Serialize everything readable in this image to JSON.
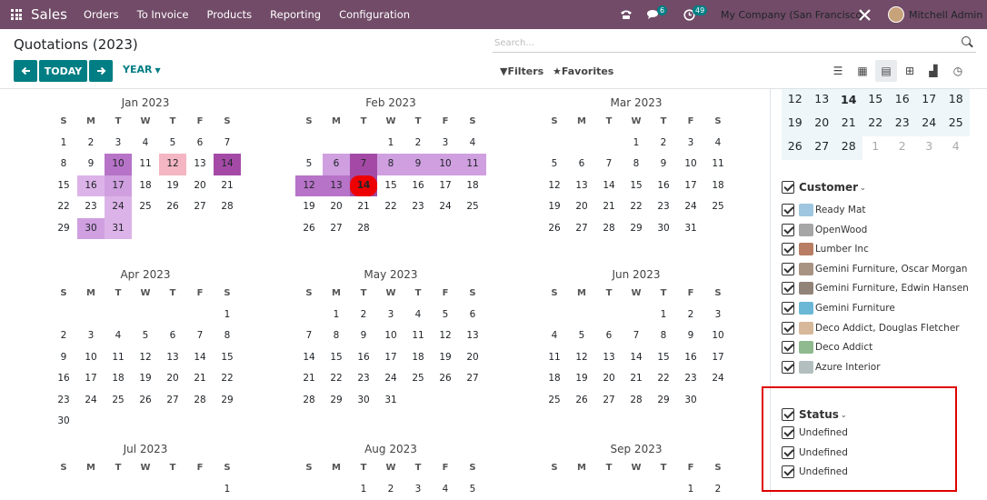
{
  "topbar": {
    "app_name": "Sales",
    "menu": [
      "Orders",
      "To Invoice",
      "Products",
      "Reporting",
      "Configuration"
    ],
    "chat_count": "6",
    "activity_count": "49",
    "company": "My Company (San Francisco)",
    "user": "Mitchell Admin",
    "colors": {
      "bar": "#714B67",
      "accent": "#017e84"
    }
  },
  "control": {
    "title": "Quotations (2023)",
    "today_label": "TODAY",
    "scale_label": "YEAR",
    "search_placeholder": "Search...",
    "filters_label": "Filters",
    "favorites_label": "Favorites"
  },
  "calendar": {
    "weekday_headers": [
      "S",
      "M",
      "T",
      "W",
      "T",
      "F",
      "S"
    ],
    "today_date": "Feb 14",
    "months": [
      {
        "name": "Jan 2023",
        "weeks": [
          [
            "1",
            "2",
            "3",
            "4",
            "5",
            "6",
            "7"
          ],
          [
            "8",
            "9",
            "10",
            "11",
            "12",
            "13",
            "14"
          ],
          [
            "15",
            "16",
            "17",
            "18",
            "19",
            "20",
            "21"
          ],
          [
            "22",
            "23",
            "24",
            "25",
            "26",
            "27",
            "28"
          ],
          [
            "29",
            "30",
            "31",
            "",
            "",
            "",
            ""
          ]
        ]
      },
      {
        "name": "Feb 2023",
        "weeks": [
          [
            "",
            "",
            "",
            "1",
            "2",
            "3",
            "4"
          ],
          [
            "5",
            "6",
            "7",
            "8",
            "9",
            "10",
            "11"
          ],
          [
            "12",
            "13",
            "14",
            "15",
            "16",
            "17",
            "18"
          ],
          [
            "19",
            "20",
            "21",
            "22",
            "23",
            "24",
            "25"
          ],
          [
            "26",
            "27",
            "28",
            "",
            "",
            "",
            ""
          ]
        ]
      },
      {
        "name": "Mar 2023",
        "weeks": [
          [
            "",
            "",
            "",
            "1",
            "2",
            "3",
            "4"
          ],
          [
            "5",
            "6",
            "7",
            "8",
            "9",
            "10",
            "11"
          ],
          [
            "12",
            "13",
            "14",
            "15",
            "16",
            "17",
            "18"
          ],
          [
            "19",
            "20",
            "21",
            "22",
            "23",
            "24",
            "25"
          ],
          [
            "26",
            "27",
            "28",
            "29",
            "30",
            "31",
            ""
          ]
        ]
      },
      {
        "name": "Apr 2023",
        "weeks": [
          [
            "",
            "",
            "",
            "",
            "",
            "",
            "1"
          ],
          [
            "2",
            "3",
            "4",
            "5",
            "6",
            "7",
            "8"
          ],
          [
            "9",
            "10",
            "11",
            "12",
            "13",
            "14",
            "15"
          ],
          [
            "16",
            "17",
            "18",
            "19",
            "20",
            "21",
            "22"
          ],
          [
            "23",
            "24",
            "25",
            "26",
            "27",
            "28",
            "29"
          ],
          [
            "30",
            "",
            "",
            "",
            "",
            "",
            ""
          ]
        ]
      },
      {
        "name": "May 2023",
        "weeks": [
          [
            "",
            "1",
            "2",
            "3",
            "4",
            "5",
            "6"
          ],
          [
            "7",
            "8",
            "9",
            "10",
            "11",
            "12",
            "13"
          ],
          [
            "14",
            "15",
            "16",
            "17",
            "18",
            "19",
            "20"
          ],
          [
            "21",
            "22",
            "23",
            "24",
            "25",
            "26",
            "27"
          ],
          [
            "28",
            "29",
            "30",
            "31",
            "",
            "",
            ""
          ]
        ]
      },
      {
        "name": "Jun 2023",
        "weeks": [
          [
            "",
            "",
            "",
            "",
            "1",
            "2",
            "3"
          ],
          [
            "4",
            "5",
            "6",
            "7",
            "8",
            "9",
            "10"
          ],
          [
            "11",
            "12",
            "13",
            "14",
            "15",
            "16",
            "17"
          ],
          [
            "18",
            "19",
            "20",
            "21",
            "22",
            "23",
            "24"
          ],
          [
            "25",
            "26",
            "27",
            "28",
            "29",
            "30",
            ""
          ]
        ]
      },
      {
        "name": "Jul 2023",
        "weeks": [
          [
            "",
            "",
            "",
            "",
            "",
            "",
            "1"
          ]
        ]
      },
      {
        "name": "Aug 2023",
        "weeks": [
          [
            "",
            "",
            "1",
            "2",
            "3",
            "4",
            "5"
          ]
        ]
      },
      {
        "name": "Sep 2023",
        "weeks": [
          [
            "",
            "",
            "",
            "",
            "",
            "1",
            "2"
          ]
        ]
      }
    ],
    "highlights": [
      {
        "month": 0,
        "days": {
          "10": "#b773c7",
          "12": "#f4b6c2",
          "14": "#a44aa6",
          "16": "#dcb3e8",
          "17": "#cf9fe0",
          "24": "#dcb3e8",
          "30": "#cf9fe0",
          "31": "#dcb3e8"
        }
      },
      {
        "month": 1,
        "days": {
          "6": "#cf9fe0",
          "7": "#a44aa6",
          "8": "#cf9fe0",
          "9": "#cf9fe0",
          "10": "#cf9fe0",
          "11": "#cf9fe0",
          "12": "#b773c7",
          "13": "#b773c7",
          "14": "#a44aa6"
        }
      }
    ]
  },
  "mini_calendar": {
    "rows": [
      [
        "12",
        "13",
        "14",
        "15",
        "16",
        "17",
        "18"
      ],
      [
        "19",
        "20",
        "21",
        "22",
        "23",
        "24",
        "25"
      ],
      [
        "26",
        "27",
        "28",
        "1",
        "2",
        "3",
        "4"
      ]
    ]
  },
  "filters": {
    "customer_title": "Customer",
    "customers": [
      "Ready Mat",
      "OpenWood",
      "Lumber Inc",
      "Gemini Furniture, Oscar Morgan",
      "Gemini Furniture, Edwin Hansen",
      "Gemini Furniture",
      "Deco Addict, Douglas Fletcher",
      "Deco Addict",
      "Azure Interior"
    ],
    "status_title": "Status",
    "statuses": [
      "Undefined",
      "Undefined",
      "Undefined"
    ]
  }
}
